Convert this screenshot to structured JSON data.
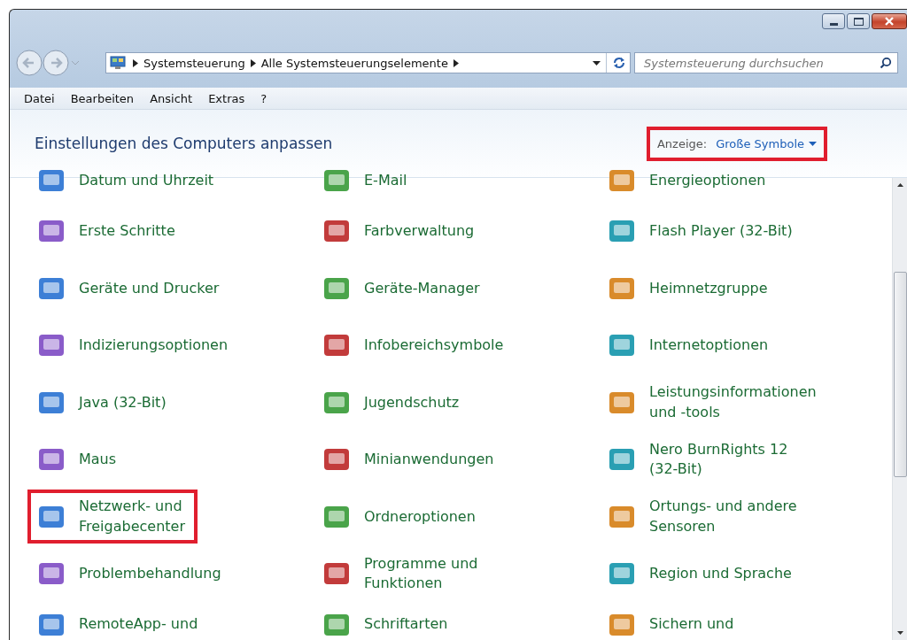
{
  "address_bar": {
    "path": [
      "Systemsteuerung",
      "Alle Systemsteuerungselemente"
    ]
  },
  "search": {
    "placeholder": "Systemsteuerung durchsuchen"
  },
  "menu": [
    "Datei",
    "Bearbeiten",
    "Ansicht",
    "Extras",
    "?"
  ],
  "header": {
    "title": "Einstellungen des Computers anpassen",
    "view_label": "Anzeige:",
    "view_value": "Große Symbole",
    "highlighted": true
  },
  "rows": [
    [
      {
        "label": "Datum und Uhrzeit",
        "highlighted": false
      },
      {
        "label": "E-Mail",
        "highlighted": false
      },
      {
        "label": "Energieoptionen",
        "highlighted": false
      }
    ],
    [
      {
        "label": "Erste Schritte",
        "highlighted": false
      },
      {
        "label": "Farbverwaltung",
        "highlighted": false
      },
      {
        "label": "Flash Player (32-Bit)",
        "highlighted": false
      }
    ],
    [
      {
        "label": "Geräte und Drucker",
        "highlighted": false
      },
      {
        "label": "Geräte-Manager",
        "highlighted": false
      },
      {
        "label": "Heimnetzgruppe",
        "highlighted": false
      }
    ],
    [
      {
        "label": "Indizierungsoptionen",
        "highlighted": false
      },
      {
        "label": "Infobereichsymbole",
        "highlighted": false
      },
      {
        "label": "Internetoptionen",
        "highlighted": false
      }
    ],
    [
      {
        "label": "Java (32-Bit)",
        "highlighted": false
      },
      {
        "label": "Jugendschutz",
        "highlighted": false
      },
      {
        "label": "Leistungsinformationen\nund -tools",
        "highlighted": false
      }
    ],
    [
      {
        "label": "Maus",
        "highlighted": false
      },
      {
        "label": "Minianwendungen",
        "highlighted": false
      },
      {
        "label": "Nero BurnRights 12\n(32-Bit)",
        "highlighted": false
      }
    ],
    [
      {
        "label": "Netzwerk- und\nFreigabecenter",
        "highlighted": true
      },
      {
        "label": "Ordneroptionen",
        "highlighted": false
      },
      {
        "label": "Ortungs- und andere\nSensoren",
        "highlighted": false
      }
    ],
    [
      {
        "label": "Problembehandlung",
        "highlighted": false
      },
      {
        "label": "Programme und\nFunktionen",
        "highlighted": false
      },
      {
        "label": "Region und Sprache",
        "highlighted": false
      }
    ],
    [
      {
        "label": "RemoteApp- und",
        "highlighted": false
      },
      {
        "label": "Schriftarten",
        "highlighted": false
      },
      {
        "label": "Sichern und",
        "highlighted": false
      }
    ]
  ]
}
